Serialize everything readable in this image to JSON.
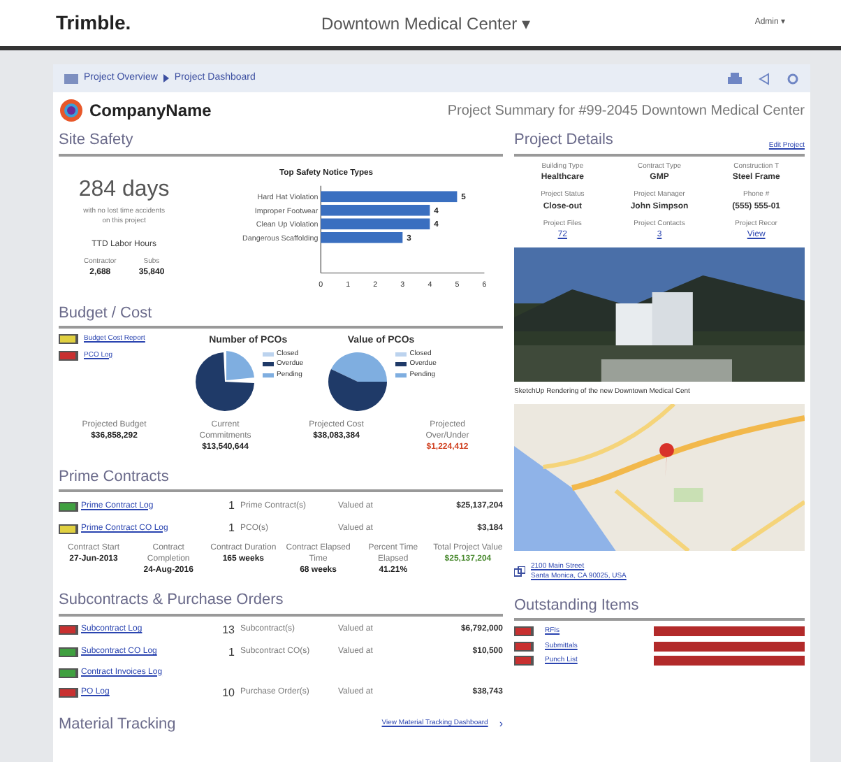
{
  "top_bar": {
    "logo": "Trimble.",
    "project": "Downtown Medical Center ▾",
    "user": "Admin ▾"
  },
  "breadcrumb": [
    "Project Overview",
    "Project Dashboard"
  ],
  "header": {
    "company": "CompanyName",
    "title": "Project Summary for #99-2045 Downtown Medical Center"
  },
  "site_safety": {
    "heading": "Site Safety",
    "days": "284 days",
    "days_note": "with no lost time accidents on this project",
    "hours_label": "TTD Labor Hours",
    "stats": [
      {
        "label": "Contractor",
        "value": "2,688"
      },
      {
        "label": "Subs",
        "value": "35,840"
      }
    ],
    "chart_data": {
      "type": "bar",
      "orientation": "horizontal",
      "title": "Top Safety Notice Types",
      "categories": [
        "Hard Hat Violation",
        "Improper Footwear",
        "Clean Up Violation",
        "Dangerous Scaffolding"
      ],
      "series": [
        {
          "color": "#3a6fc0",
          "values": [
            5,
            4,
            4,
            3
          ]
        }
      ],
      "xlim": [
        0,
        6
      ],
      "xticks": [
        0,
        1,
        2,
        3,
        4,
        5,
        6
      ],
      "data_labels": true
    }
  },
  "budget": {
    "heading": "Budget / Cost",
    "links": [
      {
        "label": "Budget Cost Report",
        "color": "#e0d040"
      },
      {
        "label": "PCO Log",
        "color": "#c83030"
      }
    ],
    "pies": [
      {
        "title": "Number of PCOs",
        "legend": [
          {
            "label": "Closed",
            "color": "#bcd3ee"
          },
          {
            "label": "Overdue",
            "color": "#1f3a68"
          },
          {
            "label": "Pending",
            "color": "#7faee0"
          }
        ]
      },
      {
        "title": "Value of PCOs",
        "legend": [
          {
            "label": "Closed",
            "color": "#bcd3ee"
          },
          {
            "label": "Overdue",
            "color": "#1f3a68"
          },
          {
            "label": "Pending",
            "color": "#7faee0"
          }
        ]
      }
    ],
    "totals": [
      {
        "label": "Projected Budget",
        "value": "$36,858,292",
        "kind": "normal"
      },
      {
        "label": "Current Commitments",
        "value": "$13,540,644",
        "kind": "normal"
      },
      {
        "label": "Projected Cost",
        "value": "$38,083,384",
        "kind": "normal"
      },
      {
        "label": "Projected Over/Under",
        "value": "$1,224,412",
        "kind": "negative"
      }
    ]
  },
  "prime_contracts": {
    "heading": "Prime Contracts",
    "rows": [
      {
        "link": "Prime Contract Log",
        "color": "#40a040",
        "count": "1",
        "item": "Prime Contract(s)",
        "valued": "Valued at",
        "amount": "$25,137,204"
      },
      {
        "link": "Prime Contract CO Log",
        "color": "#e0d040",
        "count": "1",
        "item": "PCO(s)",
        "valued": "Valued at",
        "amount": "$3,184"
      }
    ],
    "stats": [
      {
        "label": "Contract Start",
        "value": "27-Jun-2013",
        "kind": "normal"
      },
      {
        "label": "Contract Completion",
        "value": "24-Aug-2016",
        "kind": "normal"
      },
      {
        "label": "Contract Duration",
        "value": "165 weeks",
        "kind": "normal"
      },
      {
        "label": "Contract Elapsed Time",
        "value": "68 weeks",
        "kind": "normal"
      },
      {
        "label": "Percent Time Elapsed",
        "value": "41.21%",
        "kind": "normal"
      },
      {
        "label": "Total Project Value",
        "value": "$25,137,204",
        "kind": "positive"
      }
    ]
  },
  "subcontracts": {
    "heading": "Subcontracts & Purchase Orders",
    "rows": [
      {
        "link": "Subcontract Log",
        "color": "#c83030",
        "count": "13",
        "item": "Subcontract(s)",
        "valued": "Valued at",
        "amount": "$6,792,000"
      },
      {
        "link": "Subcontract CO Log",
        "color": "#40a040",
        "count": "1",
        "item": "Subcontract CO(s)",
        "valued": "Valued at",
        "amount": "$10,500"
      },
      {
        "link": "Contract Invoices Log",
        "color": "#40a040"
      },
      {
        "link": "PO Log",
        "color": "#c83030",
        "count": "10",
        "item": "Purchase Order(s)",
        "valued": "Valued at",
        "amount": "$38,743"
      }
    ]
  },
  "material_tracking": {
    "heading": "Material Tracking",
    "link": "View Material Tracking Dashboard",
    "arrow": "›"
  },
  "project_details": {
    "heading": "Project Details",
    "edit": "Edit Project",
    "fields": [
      {
        "label": "Building Type",
        "value": "Healthcare",
        "kind": "text"
      },
      {
        "label": "Contract Type",
        "value": "GMP",
        "kind": "text"
      },
      {
        "label": "Construction T",
        "value": "Steel Frame",
        "kind": "text"
      },
      {
        "label": "Project Status",
        "value": "Close-out",
        "kind": "text"
      },
      {
        "label": "Project Manager",
        "value": "John Simpson",
        "kind": "text"
      },
      {
        "label": "Phone #",
        "value": "(555) 555-01",
        "kind": "text"
      },
      {
        "label": "Project Files",
        "value": "72",
        "kind": "link"
      },
      {
        "label": "Project Contacts",
        "value": "3",
        "kind": "link"
      },
      {
        "label": "Project Recor",
        "value": "View",
        "kind": "link"
      }
    ],
    "caption": "SketchUp Rendering of the new Downtown Medical Cent",
    "address": [
      "2100 Main Street",
      "Santa Monica, CA 90025, USA"
    ]
  },
  "outstanding": {
    "heading": "Outstanding Items",
    "rows": [
      {
        "label": "RFIs"
      },
      {
        "label": "Submittals"
      },
      {
        "label": "Punch List"
      }
    ]
  }
}
